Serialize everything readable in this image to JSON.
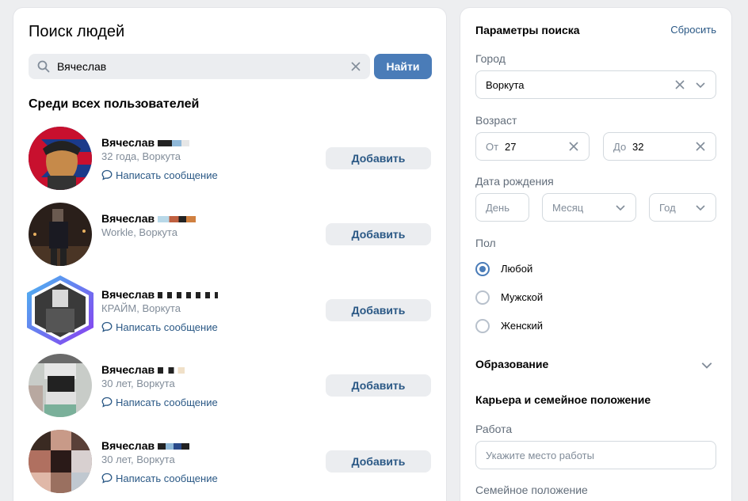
{
  "search_panel": {
    "title": "Поиск людей",
    "query": "Вячеслав",
    "find_label": "Найти",
    "section_title": "Среди всех пользователей"
  },
  "users": [
    {
      "name": "Вячеслав",
      "subtitle": "32 года, Воркута",
      "message_label": "Написать сообщение",
      "add_label": "Добавить"
    },
    {
      "name": "Вячеслав",
      "subtitle": "Workle, Воркута",
      "message_label": "",
      "add_label": "Добавить"
    },
    {
      "name": "Вячеслав",
      "subtitle": "КРАЙМ, Воркута",
      "message_label": "Написать сообщение",
      "add_label": "Добавить"
    },
    {
      "name": "Вячеслав",
      "subtitle": "30 лет, Воркута",
      "message_label": "Написать сообщение",
      "add_label": "Добавить"
    },
    {
      "name": "Вячеслав",
      "subtitle": "30 лет, Воркута",
      "message_label": "Написать сообщение",
      "add_label": "Добавить"
    }
  ],
  "params": {
    "title": "Параметры поиска",
    "reset_label": "Сбросить",
    "city_label": "Город",
    "city_value": "Воркута",
    "age_label": "Возраст",
    "age_from_prefix": "От",
    "age_from_value": "27",
    "age_to_prefix": "До",
    "age_to_value": "32",
    "birth_label": "Дата рождения",
    "day_placeholder": "День",
    "month_placeholder": "Месяц",
    "year_placeholder": "Год",
    "sex_label": "Пол",
    "sex_options": [
      "Любой",
      "Мужской",
      "Женский"
    ],
    "sex_selected": "Любой",
    "education_label": "Образование",
    "career_label": "Карьера и семейное положение",
    "work_label": "Работа",
    "work_placeholder": "Укажите место работы",
    "family_label": "Семейное положение"
  },
  "colors": {
    "accent": "#4a7cb8",
    "link": "#2a5885",
    "muted": "#818c99"
  },
  "icons": [
    "search-icon",
    "clear-icon",
    "message-icon",
    "chevron-down-icon"
  ]
}
